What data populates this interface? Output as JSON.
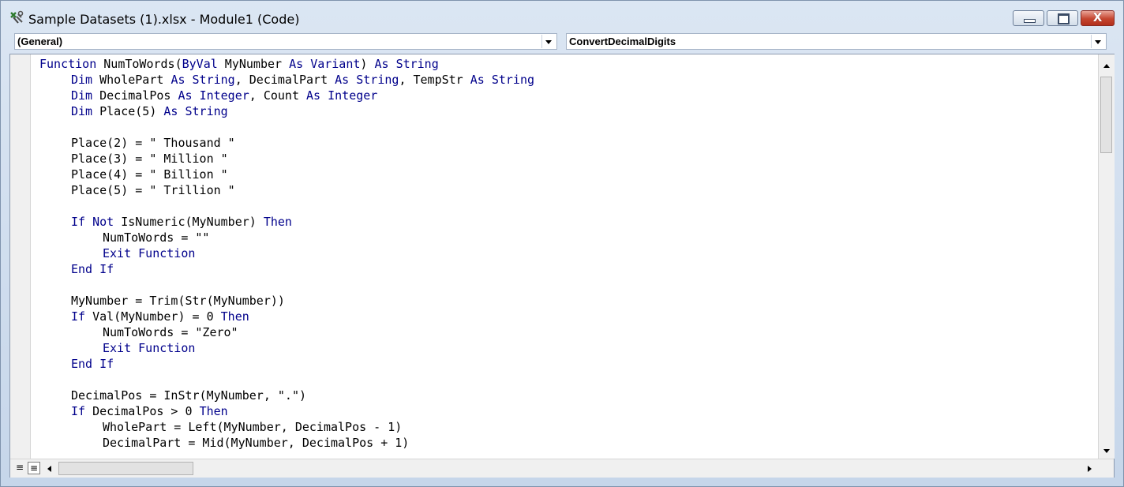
{
  "window": {
    "title": "Sample Datasets (1).xlsx - Module1 (Code)",
    "icon": "vba-module-icon"
  },
  "controls": {
    "minimize": "minimize",
    "maximize": "maximize",
    "close_glyph": "X"
  },
  "object_combo": {
    "value": "(General)"
  },
  "procedure_combo": {
    "value": "ConvertDecimalDigits"
  },
  "colors": {
    "keyword": "#00008b",
    "text": "#000000",
    "close": "#c5452f"
  },
  "code_lines": [
    {
      "indent": 0,
      "tokens": [
        [
          "kw",
          "Function"
        ],
        [
          "t",
          " NumToWords("
        ],
        [
          "kw",
          "ByVal"
        ],
        [
          "t",
          " MyNumber "
        ],
        [
          "kw",
          "As"
        ],
        [
          "t",
          " "
        ],
        [
          "kw",
          "Variant"
        ],
        [
          "t",
          ") "
        ],
        [
          "kw",
          "As"
        ],
        [
          "t",
          " "
        ],
        [
          "kw",
          "String"
        ]
      ]
    },
    {
      "indent": 1,
      "tokens": [
        [
          "kw",
          "Dim"
        ],
        [
          "t",
          " WholePart "
        ],
        [
          "kw",
          "As"
        ],
        [
          "t",
          " "
        ],
        [
          "kw",
          "String"
        ],
        [
          "t",
          ", DecimalPart "
        ],
        [
          "kw",
          "As"
        ],
        [
          "t",
          " "
        ],
        [
          "kw",
          "String"
        ],
        [
          "t",
          ", TempStr "
        ],
        [
          "kw",
          "As"
        ],
        [
          "t",
          " "
        ],
        [
          "kw",
          "String"
        ]
      ]
    },
    {
      "indent": 1,
      "tokens": [
        [
          "kw",
          "Dim"
        ],
        [
          "t",
          " DecimalPos "
        ],
        [
          "kw",
          "As"
        ],
        [
          "t",
          " "
        ],
        [
          "kw",
          "Integer"
        ],
        [
          "t",
          ", Count "
        ],
        [
          "kw",
          "As"
        ],
        [
          "t",
          " "
        ],
        [
          "kw",
          "Integer"
        ]
      ]
    },
    {
      "indent": 1,
      "tokens": [
        [
          "kw",
          "Dim"
        ],
        [
          "t",
          " Place(5) "
        ],
        [
          "kw",
          "As"
        ],
        [
          "t",
          " "
        ],
        [
          "kw",
          "String"
        ]
      ]
    },
    {
      "indent": 0,
      "tokens": []
    },
    {
      "indent": 1,
      "tokens": [
        [
          "t",
          "Place(2) = \" Thousand \""
        ]
      ]
    },
    {
      "indent": 1,
      "tokens": [
        [
          "t",
          "Place(3) = \" Million \""
        ]
      ]
    },
    {
      "indent": 1,
      "tokens": [
        [
          "t",
          "Place(4) = \" Billion \""
        ]
      ]
    },
    {
      "indent": 1,
      "tokens": [
        [
          "t",
          "Place(5) = \" Trillion \""
        ]
      ]
    },
    {
      "indent": 0,
      "tokens": []
    },
    {
      "indent": 1,
      "tokens": [
        [
          "kw",
          "If"
        ],
        [
          "t",
          " "
        ],
        [
          "kw",
          "Not"
        ],
        [
          "t",
          " IsNumeric(MyNumber) "
        ],
        [
          "kw",
          "Then"
        ]
      ]
    },
    {
      "indent": 2,
      "tokens": [
        [
          "t",
          "NumToWords = \"\""
        ]
      ]
    },
    {
      "indent": 2,
      "tokens": [
        [
          "kw",
          "Exit"
        ],
        [
          "t",
          " "
        ],
        [
          "kw",
          "Function"
        ]
      ]
    },
    {
      "indent": 1,
      "tokens": [
        [
          "kw",
          "End"
        ],
        [
          "t",
          " "
        ],
        [
          "kw",
          "If"
        ]
      ]
    },
    {
      "indent": 0,
      "tokens": []
    },
    {
      "indent": 1,
      "tokens": [
        [
          "t",
          "MyNumber = Trim(Str(MyNumber))"
        ]
      ]
    },
    {
      "indent": 1,
      "tokens": [
        [
          "kw",
          "If"
        ],
        [
          "t",
          " Val(MyNumber) = 0 "
        ],
        [
          "kw",
          "Then"
        ]
      ]
    },
    {
      "indent": 2,
      "tokens": [
        [
          "t",
          "NumToWords = \"Zero\""
        ]
      ]
    },
    {
      "indent": 2,
      "tokens": [
        [
          "kw",
          "Exit"
        ],
        [
          "t",
          " "
        ],
        [
          "kw",
          "Function"
        ]
      ]
    },
    {
      "indent": 1,
      "tokens": [
        [
          "kw",
          "End"
        ],
        [
          "t",
          " "
        ],
        [
          "kw",
          "If"
        ]
      ]
    },
    {
      "indent": 0,
      "tokens": []
    },
    {
      "indent": 1,
      "tokens": [
        [
          "t",
          "DecimalPos = InStr(MyNumber, \".\")"
        ]
      ]
    },
    {
      "indent": 1,
      "tokens": [
        [
          "kw",
          "If"
        ],
        [
          "t",
          " DecimalPos > 0 "
        ],
        [
          "kw",
          "Then"
        ]
      ]
    },
    {
      "indent": 2,
      "tokens": [
        [
          "t",
          "WholePart = Left(MyNumber, DecimalPos - 1)"
        ]
      ]
    },
    {
      "indent": 2,
      "tokens": [
        [
          "t",
          "DecimalPart = Mid(MyNumber, DecimalPos + 1)"
        ]
      ]
    }
  ]
}
